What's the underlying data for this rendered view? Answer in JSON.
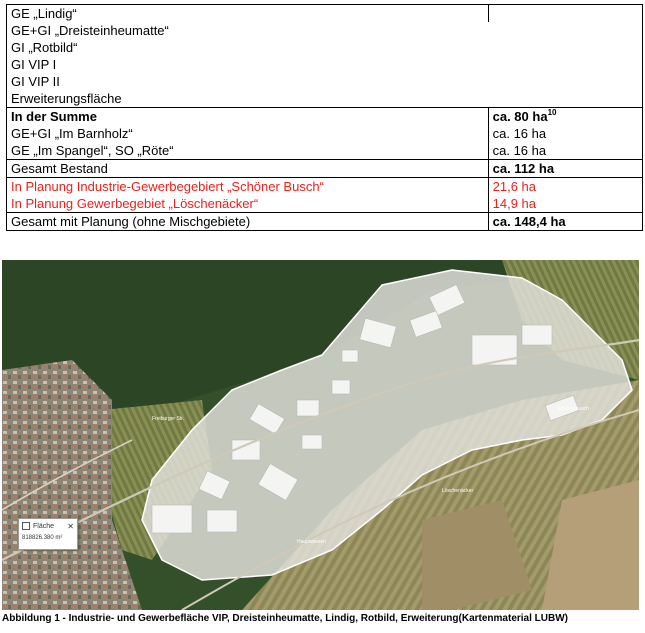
{
  "table": {
    "group_rows": [
      "GE „Lindig“",
      "GE+GI „Dreisteinheumatte“",
      "GI „Rotbild“",
      "GI VIP I",
      "GI VIP II",
      "Erweiterungsfläche"
    ],
    "sum_label": "In der Summe",
    "sum_value": "ca. 80 ha",
    "sum_footnote": "10",
    "rows2": [
      {
        "label": "GE+GI „Im Barnholz“",
        "value": "ca. 16 ha"
      },
      {
        "label": "GE „Im Spangel“, SO „Röte“",
        "value": "ca. 16 ha"
      }
    ],
    "total_label": "Gesamt Bestand",
    "total_value": "ca. 112 ha",
    "planned": [
      {
        "label": "In Planung Industrie-Gewerbegebiert „Schöner Busch“",
        "value": "21,6 ha"
      },
      {
        "label": "In Planung Gewerbegebiet „Löschenäcker“",
        "value": "14,9 ha"
      }
    ],
    "grand_label": "Gesamt mit Planung (ohne Mischgebiete)",
    "grand_value": "ca. 148,4 ha"
  },
  "map": {
    "tooltip_title": "Fläche",
    "tooltip_value": "818826.380 m²",
    "colors": {
      "forest": "#2f4a22",
      "fields": "#8f8a5a",
      "urban": "#9c8f7d",
      "highlight": "#e9e9e6"
    }
  },
  "caption": "Abbildung 1 - Industrie- und Gewerbefläche VIP, Dreisteinheumatte, Lindig, Rotbild, Erweiterung(Kartenmaterial LUBW)"
}
